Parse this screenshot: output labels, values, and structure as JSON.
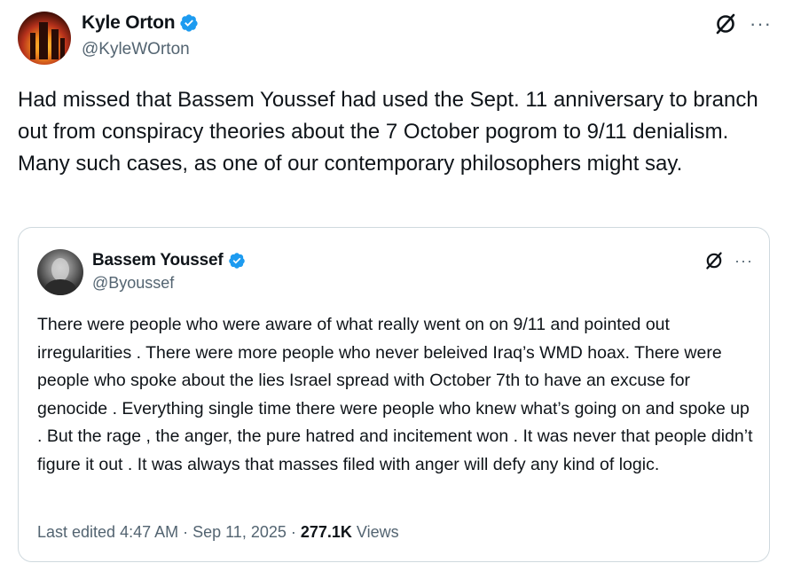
{
  "author": {
    "name": "Kyle Orton",
    "handle": "@KyleWOrton",
    "verified_color": "#1d9bf0"
  },
  "tweet": {
    "text": "Had missed that Bassem Youssef had used the Sept. 11 anniversary to branch out from conspiracy theories about the 7 October pogrom to 9/11 denialism. Many such cases, as one of our contemporary philosophers might say."
  },
  "actions": {
    "grok_icon": "grok-icon",
    "more_label": "···"
  },
  "quoted": {
    "name": "Bassem Youssef",
    "handle": "@Byoussef",
    "text": "There were people who were aware of what really went on on 9/11 and pointed out irregularities . There were more people who never beleived  Iraq’s WMD hoax. There were people who spoke about the lies Israel spread with October 7th to have an excuse for genocide  . Everything single time there were people who knew what’s going on and spoke up . But the rage , the anger, the pure hatred and incitement won . It was never that people didn’t figure it out . It was always that masses filed with anger will defy any kind of logic.",
    "edited_time": "Last edited 4:47 AM · Sep 11, 2025 · ",
    "views_count": "277.1K",
    "views_label": " Views",
    "more_label": "···"
  },
  "colors": {
    "text": "#0f1419",
    "secondary": "#536471",
    "border": "#cfd9de",
    "verified": "#1d9bf0"
  }
}
